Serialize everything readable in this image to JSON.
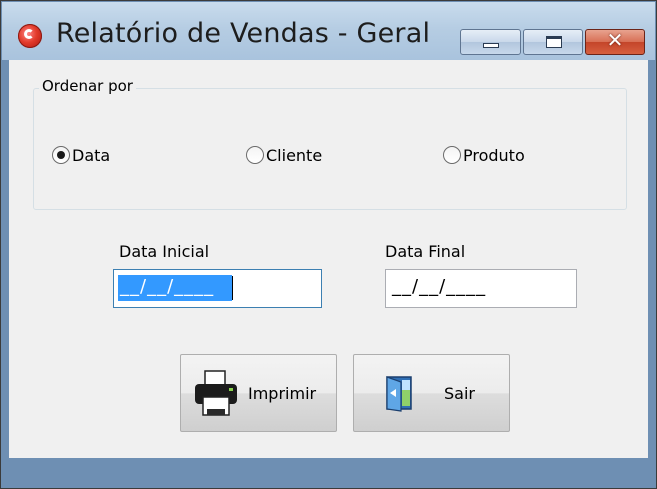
{
  "window": {
    "title": "Relatório de Vendas - Geral",
    "controls": {
      "minimize_icon": "minimize-icon",
      "maximize_icon": "maximize-icon",
      "close_glyph": "✕"
    }
  },
  "sort_group": {
    "label": "Ordenar por",
    "options": [
      {
        "label": "Data",
        "selected": true
      },
      {
        "label": "Cliente",
        "selected": false
      },
      {
        "label": "Produto",
        "selected": false
      }
    ]
  },
  "date_fields": {
    "initial": {
      "label": "Data Inicial",
      "value": "__/__/____"
    },
    "final": {
      "label": "Data Final",
      "value": "__/__/____"
    }
  },
  "buttons": {
    "print": {
      "label": "Imprimir",
      "icon": "printer-icon"
    },
    "exit": {
      "label": "Sair",
      "icon": "door-exit-icon"
    }
  },
  "colors": {
    "titlebar": "#b6cde3",
    "close_button": "#c4452a",
    "selection": "#3399ff",
    "background": "#f0f0f0"
  }
}
